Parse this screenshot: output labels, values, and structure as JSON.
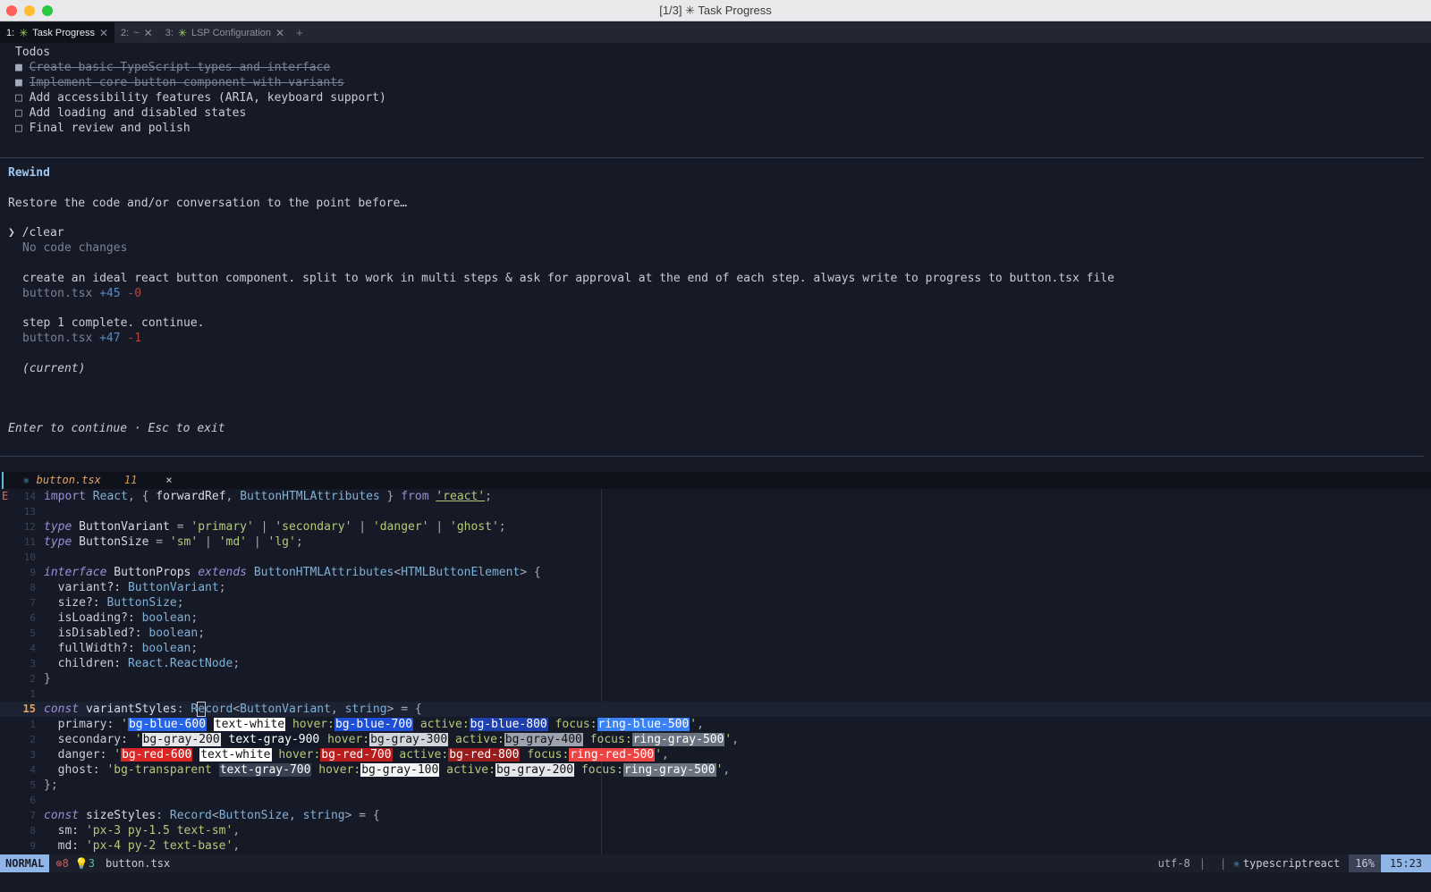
{
  "window": {
    "title": "[1/3] ✳ Task Progress"
  },
  "tabs": [
    {
      "index": "1:",
      "label": "Task Progress",
      "close": "✕"
    },
    {
      "index": "2:",
      "label": "~",
      "close": "✕"
    },
    {
      "index": "3:",
      "label": "LSP Configuration",
      "close": "✕"
    }
  ],
  "tab_add": "+",
  "todos": {
    "heading": "Todos",
    "items": [
      {
        "box": "■",
        "text": "Create basic TypeScript types and interface"
      },
      {
        "box": "■",
        "text": "Implement core button component with variants"
      },
      {
        "box": "□",
        "text": "Add accessibility features (ARIA, keyboard support)"
      },
      {
        "box": "□",
        "text": "Add loading and disabled states"
      },
      {
        "box": "□",
        "text": "Final review and polish"
      }
    ]
  },
  "rewind": {
    "title": "Rewind",
    "description": "Restore the code and/or conversation to the point before…",
    "pointer": "❯",
    "entries": [
      {
        "prompt": "/clear",
        "detail": "No code changes"
      },
      {
        "prompt": "create an ideal react button component. split to work in multi steps & ask for approval at the end of each step. always write to progress to button.tsx file",
        "file": "button.tsx",
        "added": "+45",
        "removed": "-0"
      },
      {
        "prompt": "step 1 complete. continue.",
        "file": "button.tsx",
        "added": "+47",
        "removed": "-1"
      }
    ],
    "current": "(current)",
    "hint": "Enter to continue · Esc to exit"
  },
  "editor": {
    "file_name": "button.tsx",
    "modified_count": "11",
    "close": "×",
    "error_sign": "E",
    "line_numbers": [
      "14",
      "13",
      "12",
      "11",
      "10",
      "9",
      "8",
      "7",
      "6",
      "5",
      "4",
      "3",
      "2",
      "1",
      "15",
      "1",
      "2",
      "3",
      "4",
      "5",
      "6",
      "7",
      "8",
      "9"
    ]
  },
  "status": {
    "mode": "NORMAL",
    "errors": "⊗8",
    "hints": "💡3",
    "file": "button.tsx",
    "encoding": "utf-8",
    "separator": "|",
    "os_icon": "",
    "filetype": "typescriptreact",
    "percent": "16%",
    "position": "15:23"
  }
}
